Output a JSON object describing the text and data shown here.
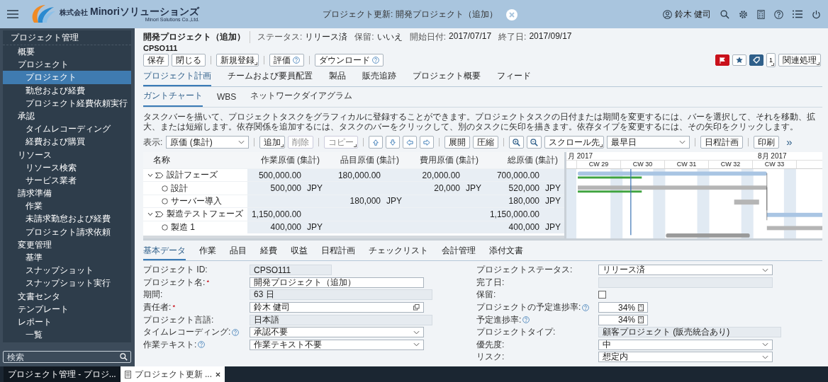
{
  "header": {
    "logo_prefix": "株式会社",
    "logo_name": "Minoriソリューションズ",
    "logo_subtitle": "Minori Solutions Co.,Ltd.",
    "title": "プロジェクト更新: 開発プロジェクト（追加）",
    "user": "鈴木 健司"
  },
  "sidebar": {
    "title": "プロジェクト管理",
    "items": [
      {
        "label": "概要",
        "selected": false
      },
      {
        "label": "プロジェクト",
        "selected": false,
        "children": [
          {
            "label": "プロジェクト",
            "selected": true
          },
          {
            "label": "勤怠および経費",
            "selected": false
          },
          {
            "label": "プロジェクト経費依頼実行",
            "selected": false
          }
        ]
      },
      {
        "label": "承認",
        "selected": false,
        "children": [
          {
            "label": "タイムレコーディング",
            "selected": false
          },
          {
            "label": "経費および購買",
            "selected": false
          }
        ]
      },
      {
        "label": "リソース",
        "selected": false,
        "children": [
          {
            "label": "リソース検索",
            "selected": false
          },
          {
            "label": "サービス業者",
            "selected": false
          }
        ]
      },
      {
        "label": "請求準備",
        "selected": false,
        "children": [
          {
            "label": "作業",
            "selected": false
          },
          {
            "label": "未請求勤怠および経費",
            "selected": false
          },
          {
            "label": "プロジェクト請求依頼",
            "selected": false
          }
        ]
      },
      {
        "label": "変更管理",
        "selected": false,
        "children": [
          {
            "label": "基準",
            "selected": false
          },
          {
            "label": "スナップショット",
            "selected": false
          },
          {
            "label": "スナップショット実行",
            "selected": false
          }
        ]
      },
      {
        "label": "文書センタ",
        "selected": false
      },
      {
        "label": "テンプレート",
        "selected": false
      },
      {
        "label": "レポート",
        "selected": false,
        "children": [
          {
            "label": "一覧",
            "selected": false
          }
        ]
      }
    ],
    "search": {
      "placeholder": "検索"
    }
  },
  "project": {
    "name": "開発プロジェクト（追加）",
    "id": "CPSO111",
    "facts": [
      {
        "label": "ステータス:",
        "value": "リリース済"
      },
      {
        "label": "保留:",
        "value": "いいえ"
      },
      {
        "label": "開始日付:",
        "value": "2017/07/17"
      },
      {
        "label": "終了日:",
        "value": "2017/09/17"
      }
    ]
  },
  "action_groups": [
    {
      "buttons": [
        {
          "label": "保存",
          "kind": "plain"
        },
        {
          "label": "閉じる",
          "kind": "plain"
        }
      ]
    },
    {
      "buttons": [
        {
          "label": "新規登録",
          "kind": "menu"
        }
      ]
    },
    {
      "buttons": [
        {
          "label": "評価",
          "kind": "help"
        }
      ]
    },
    {
      "buttons": [
        {
          "label": "ダウンロード",
          "kind": "help"
        }
      ]
    }
  ],
  "toggles": {
    "flag": {
      "on": true
    },
    "favorite": {
      "on": false
    },
    "tag": {
      "on": true
    },
    "count": "1",
    "related": "関連処理"
  },
  "tabs": [
    {
      "label": "プロジェクト計画",
      "selected": true
    },
    {
      "label": "チームおよび要員配置",
      "selected": false
    },
    {
      "label": "製品",
      "selected": false
    },
    {
      "label": "販売追跡",
      "selected": false
    },
    {
      "label": "プロジェクト概要",
      "selected": false
    },
    {
      "label": "フィード",
      "selected": false
    }
  ],
  "subtabs": [
    {
      "label": "ガントチャート",
      "selected": true
    },
    {
      "label": "WBS",
      "selected": false
    },
    {
      "label": "ネットワークダイアグラム",
      "selected": false
    }
  ],
  "description": "タスクバーを描いて、プロジェクトタスクをグラフィカルに登録することができます。プロジェクトタスクの日付または期間を変更するには、バーを選択して、それを移動、拡大、または短縮します。依存関係を追加するには、タスクのバーをクリックして、別のタスクに矢印を描きます。依存タイプを変更するには、その矢印をクリックします。",
  "gantt_toolbar": {
    "view_label": "表示:",
    "view_value": "原価 (集計)",
    "groups": [
      [
        {
          "kind": "menu",
          "label": "追加",
          "disabled": false
        },
        {
          "kind": "text",
          "label": "削除",
          "disabled": true
        }
      ],
      [
        {
          "kind": "menu",
          "label": "コピー",
          "disabled": true
        }
      ],
      [
        {
          "kind": "up",
          "disabled": false
        },
        {
          "kind": "down",
          "disabled": false
        },
        {
          "kind": "left",
          "disabled": false
        },
        {
          "kind": "right",
          "disabled": false
        }
      ],
      [
        {
          "kind": "text",
          "label": "展開",
          "disabled": false
        },
        {
          "kind": "text",
          "label": "圧縮",
          "disabled": false
        }
      ],
      [
        {
          "kind": "zoomin",
          "disabled": false
        },
        {
          "kind": "zoomout",
          "disabled": false
        },
        {
          "kind": "menu",
          "label": "スクロール先",
          "disabled": false
        },
        {
          "kind": "select",
          "label": "最早日",
          "disabled": false
        }
      ],
      [
        {
          "kind": "text",
          "label": "日程計画",
          "disabled": false
        }
      ],
      [
        {
          "kind": "text",
          "label": "印刷",
          "disabled": false
        },
        {
          "kind": "more",
          "label": "»",
          "disabled": false
        }
      ]
    ]
  },
  "gantt": {
    "name_header": "名称",
    "columns": [
      "作業原価 (集計)",
      "品目原価 (集計)",
      "費用原価 (集計)",
      "総原価 (集計)"
    ],
    "rows": [
      {
        "name": "設計フェーズ",
        "expanded": true,
        "cells": [
          {
            "amount": "500,000.00"
          },
          {
            "amount": "180,000.00"
          },
          {
            "amount": "20,000.00"
          },
          {
            "amount": "700,000.00"
          }
        ],
        "children": [
          {
            "name": "設計",
            "cells": [
              {
                "amount": "500,000",
                "currency": "JPY"
              },
              null,
              {
                "amount": "20,000",
                "currency": "JPY"
              },
              {
                "amount": "520,000",
                "currency": "JPY"
              }
            ]
          },
          {
            "name": "サーバー導入",
            "cells": [
              null,
              {
                "amount": "180,000",
                "currency": "JPY"
              },
              null,
              {
                "amount": "180,000",
                "currency": "JPY"
              }
            ]
          }
        ]
      },
      {
        "name": "製造テストフェーズ",
        "expanded": true,
        "cells": [
          {
            "amount": "1,150,000.00"
          },
          null,
          null,
          {
            "amount": "1,150,000.00"
          }
        ],
        "children": [
          {
            "name": "製造 1",
            "cells": [
              {
                "amount": "400,000",
                "currency": "JPY"
              },
              null,
              null,
              {
                "amount": "400,000",
                "currency": "JPY"
              }
            ]
          }
        ]
      }
    ],
    "months": [
      "月 2017",
      "8月 2017"
    ],
    "weeks": [
      "CW 29",
      "CW 30",
      "CW 31",
      "CW 32",
      "CW 33"
    ]
  },
  "detail_tabs": [
    {
      "label": "基本データ",
      "selected": true
    },
    {
      "label": "作業",
      "selected": false
    },
    {
      "label": "品目",
      "selected": false
    },
    {
      "label": "経費",
      "selected": false
    },
    {
      "label": "収益",
      "selected": false
    },
    {
      "label": "日程計画",
      "selected": false
    },
    {
      "label": "チェックリスト",
      "selected": false
    },
    {
      "label": "会計管理",
      "selected": false
    },
    {
      "label": "添付文書",
      "selected": false
    }
  ],
  "form_left": [
    {
      "label": "プロジェクト ID:",
      "kind": "readonly",
      "value": "CPSO111"
    },
    {
      "label": "プロジェクト名:",
      "required": true,
      "kind": "input",
      "value": "開発プロジェクト（追加）"
    },
    {
      "label": "期間:",
      "kind": "readonly",
      "value": "63 日"
    },
    {
      "label": "責任者:",
      "required": true,
      "kind": "lookup",
      "value": "鈴木 健司"
    },
    {
      "label": "プロジェクト言語:",
      "kind": "readonly",
      "value": "日本語"
    },
    {
      "label": "タイムレコーディング:",
      "help": true,
      "kind": "select",
      "value": "承認不要"
    },
    {
      "label": "作業テキスト:",
      "help": true,
      "kind": "select",
      "value": "作業テキスト不要"
    }
  ],
  "form_right": [
    {
      "label": "プロジェクトステータス:",
      "kind": "select",
      "value": "リリース済"
    },
    {
      "label": "完了日:",
      "kind": "readonly"
    },
    {
      "label": "保留:",
      "kind": "checkbox",
      "checked": false
    },
    {
      "label": "プロジェクトの予定進捗率:",
      "help": true,
      "kind": "percent",
      "value": "34%"
    },
    {
      "label": "予定進捗率:",
      "help": true,
      "kind": "percent",
      "value": "34%"
    },
    {
      "label": "プロジェクトタイプ:",
      "kind": "readonly",
      "value": "顧客プロジェクト (販売統合あり)"
    },
    {
      "label": "優先度:",
      "kind": "select",
      "value": "中"
    },
    {
      "label": "リスク:",
      "kind": "select",
      "value": "想定内"
    }
  ],
  "taskbar": [
    {
      "label": "プロジェクト管理 - プロジ...",
      "selected": false
    },
    {
      "label": "プロジェクト更新 ...",
      "selected": true
    }
  ]
}
